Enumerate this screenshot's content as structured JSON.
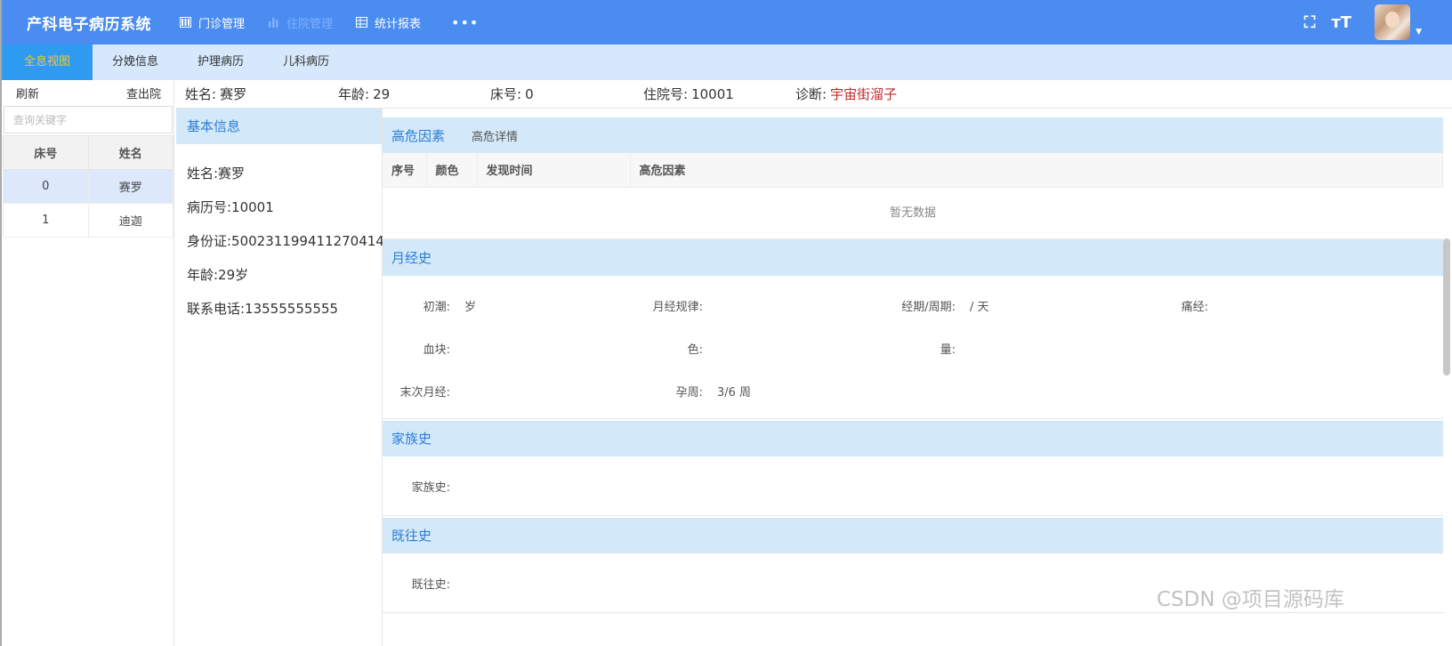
{
  "app": {
    "title": "产科电子病历系统"
  },
  "nav": {
    "items": [
      {
        "label": "门诊管理",
        "icon": "columns-icon",
        "active": false
      },
      {
        "label": "住院管理",
        "icon": "bar-chart-icon",
        "active": true
      },
      {
        "label": "统计报表",
        "icon": "table-icon",
        "active": false
      }
    ],
    "more": "•••"
  },
  "tabs": [
    {
      "label": "全息视图",
      "active": true
    },
    {
      "label": "分娩信息",
      "active": false
    },
    {
      "label": "护理病历",
      "active": false
    },
    {
      "label": "儿科病历",
      "active": false
    }
  ],
  "left": {
    "refresh": "刷新",
    "discharge": "查出院",
    "search_placeholder": "查询关键字",
    "columns": [
      "床号",
      "姓名"
    ],
    "rows": [
      [
        "0",
        "赛罗"
      ],
      [
        "1",
        "迪迦"
      ]
    ]
  },
  "patient": {
    "name_label": "姓名:",
    "name": "赛罗",
    "age_label": "年龄:",
    "age": "29",
    "bed_label": "床号:",
    "bed": "0",
    "admission_label": "住院号:",
    "admission": "10001",
    "diagnosis_label": "诊断:",
    "diagnosis": "宇宙街溜子"
  },
  "basic": {
    "title": "基本信息",
    "lines": [
      "姓名:赛罗",
      "病历号:10001",
      "身份证:500231199411270414",
      "年龄:29岁",
      "联系电话:13555555555"
    ]
  },
  "risk": {
    "title": "高危因素",
    "detail_link": "高危详情",
    "columns": [
      "序号",
      "颜色",
      "发现时间",
      "高危因素"
    ],
    "empty": "暂无数据"
  },
  "menstrual": {
    "title": "月经史",
    "menarche_label": "初潮:",
    "menarche_value": "岁",
    "regularity_label": "月经规律:",
    "regularity_value": "",
    "period_label": "经期/周期:",
    "period_value": "/ 天",
    "dysmenorrhea_label": "痛经:",
    "clot_label": "血块:",
    "color_label": "色:",
    "volume_label": "量:",
    "lmp_label": "末次月经:",
    "gest_label": "孕周:",
    "gest_value": "3/6 周"
  },
  "family": {
    "title": "家族史",
    "label": "家族史:"
  },
  "past": {
    "title": "既往史",
    "label": "既往史:"
  },
  "watermark": "CSDN @项目源码库",
  "colors": {
    "header": "#4a8cf0",
    "tab_active": "#2e9af0",
    "section_head": "#d3e8f9",
    "diagnosis": "#c0282a"
  }
}
